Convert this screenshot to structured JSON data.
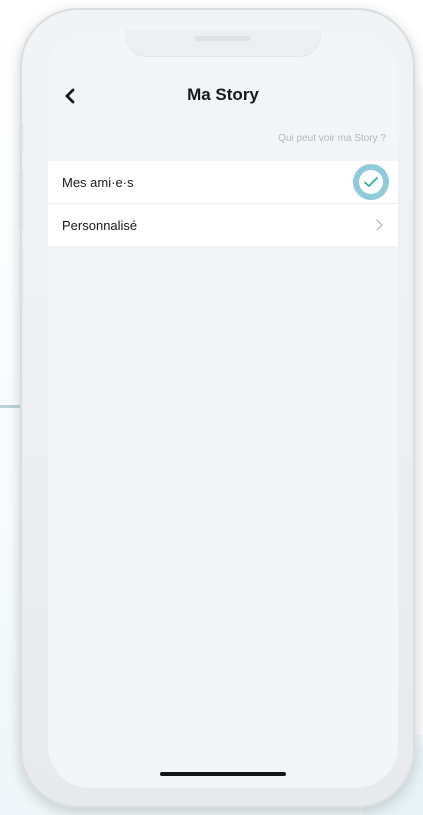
{
  "header": {
    "title": "Ma Story"
  },
  "section": {
    "header": "Qui peut voir ma Story ?"
  },
  "options": [
    {
      "label": "Mes ami·e·s",
      "selected": true
    },
    {
      "label": "Personnalisé",
      "selected": false
    }
  ],
  "colors": {
    "check": "#2bb39a",
    "highlight_ring": "#8fcbdb",
    "section_header": "#b3b8bd"
  },
  "icons": {
    "back": "chevron-left-icon",
    "selected": "checkmark-icon",
    "disclosure": "chevron-right-icon"
  }
}
